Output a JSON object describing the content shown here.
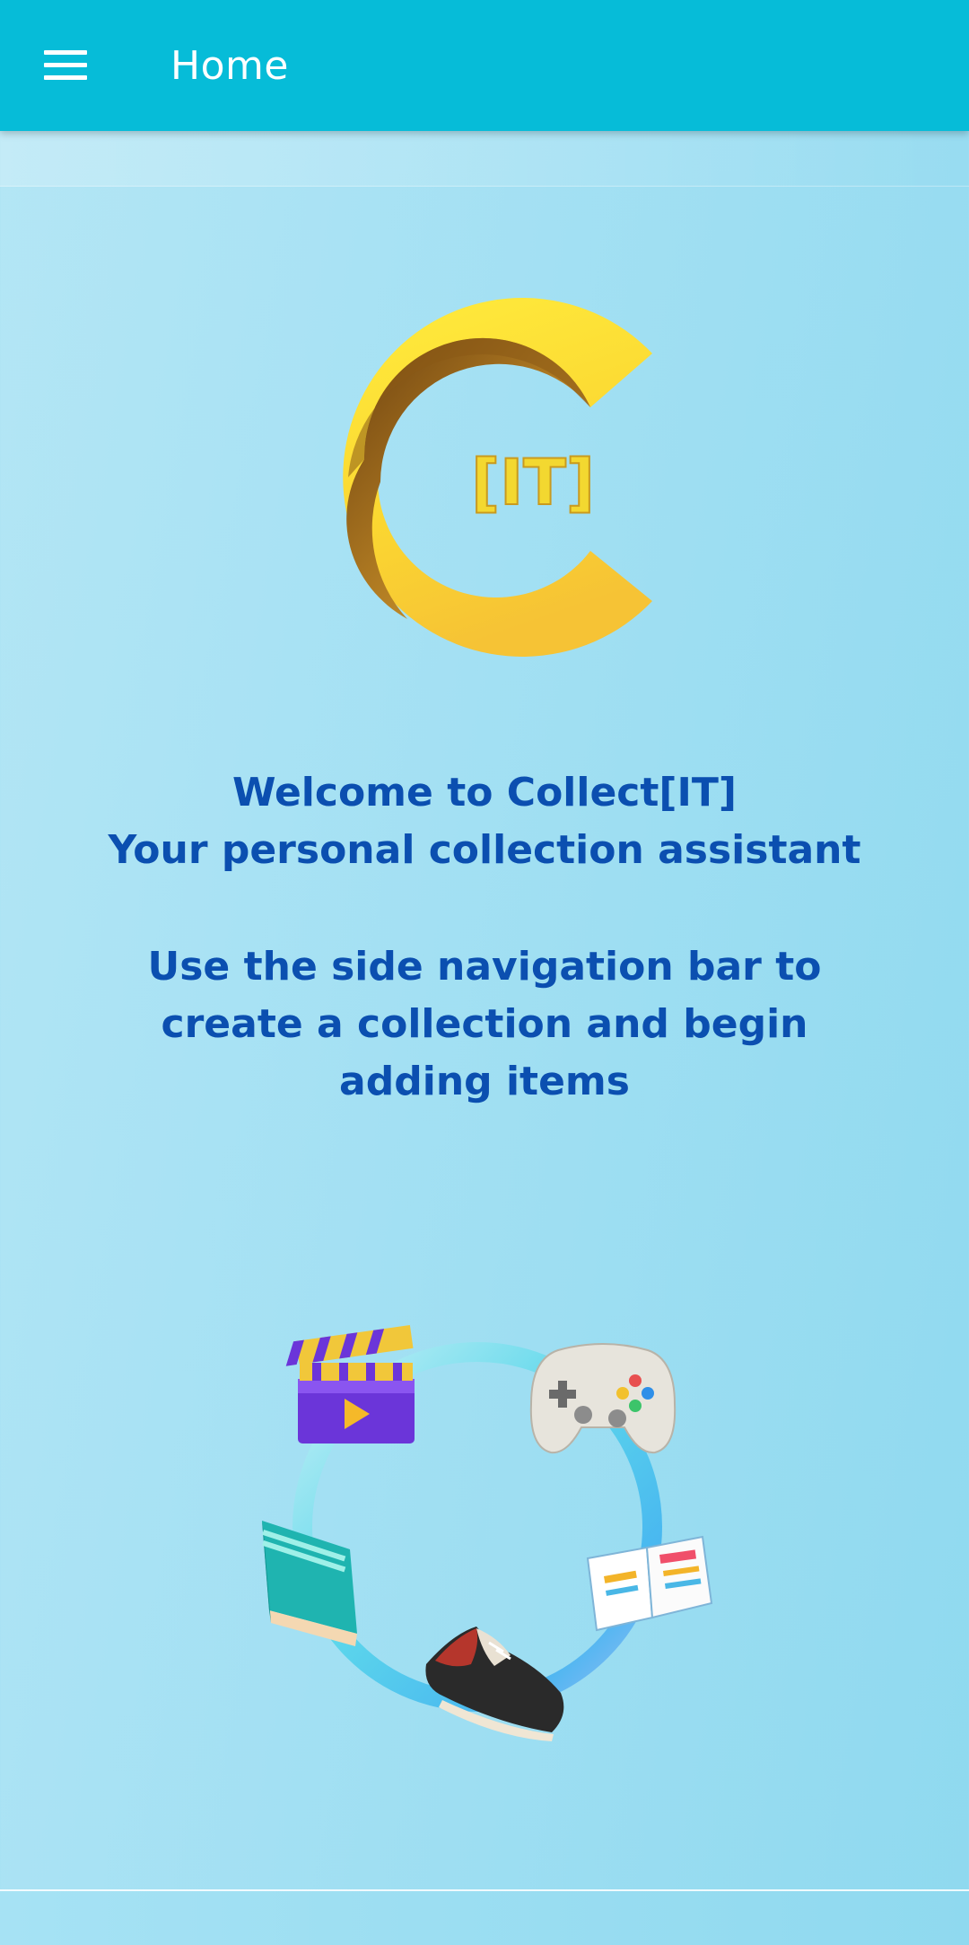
{
  "appbar": {
    "title": "Home",
    "menu_icon": "hamburger-menu-icon",
    "background": "#06bcd8"
  },
  "logo": {
    "text": "[IT]",
    "colors": {
      "primary": "#fde535",
      "shade": "#a8741d"
    }
  },
  "welcome": {
    "line1": "Welcome to Collect[IT]",
    "line2": "Your personal collection assistant",
    "instruction1": "Use the side navigation bar to",
    "instruction2": "create a collection and begin",
    "instruction3": "adding items",
    "text_color": "#0b4fb0"
  },
  "illustration": {
    "icons": [
      "clapperboard-icon",
      "game-controller-icon",
      "open-book-icon",
      "sneaker-icon",
      "closed-book-icon"
    ]
  }
}
